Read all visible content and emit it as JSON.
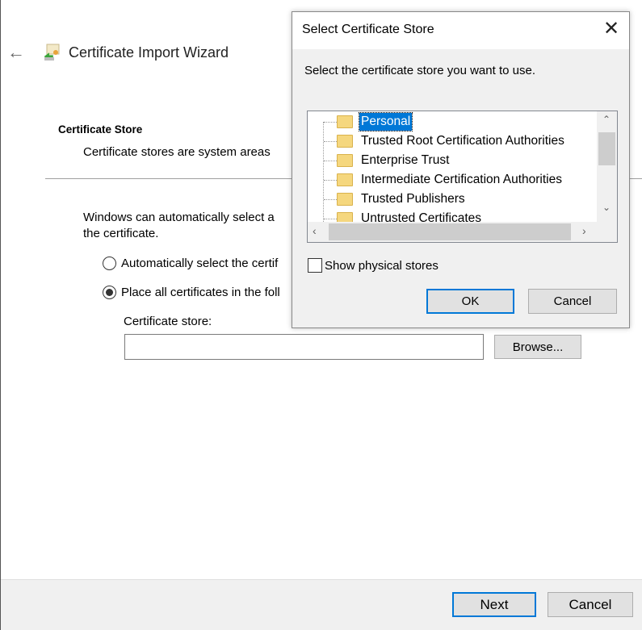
{
  "wizard": {
    "title": "Certificate Import Wizard",
    "section_title": "Certificate Store",
    "section_desc": "Certificate stores are system areas",
    "auto_text_1": "Windows can automatically select a",
    "auto_text_2": "the certificate.",
    "radio_auto_label": "Automatically select the certif",
    "radio_place_label": "Place all certificates in the foll",
    "radio_selected": "place",
    "store_label": "Certificate store:",
    "store_value": "",
    "browse_label": "Browse...",
    "next_label": "Next",
    "cancel_label": "Cancel"
  },
  "dialog": {
    "title": "Select Certificate Store",
    "prompt": "Select the certificate store you want to use.",
    "stores": [
      "Personal",
      "Trusted Root Certification Authorities",
      "Enterprise Trust",
      "Intermediate Certification Authorities",
      "Trusted Publishers",
      "Untrusted Certificates"
    ],
    "selected_store": "Personal",
    "show_physical_label": "Show physical stores",
    "show_physical_checked": false,
    "ok_label": "OK",
    "cancel_label": "Cancel"
  },
  "colors": {
    "accent": "#0078d7",
    "dialog_bg": "#f0f0f0",
    "footer_bg": "#f0f0f0"
  }
}
